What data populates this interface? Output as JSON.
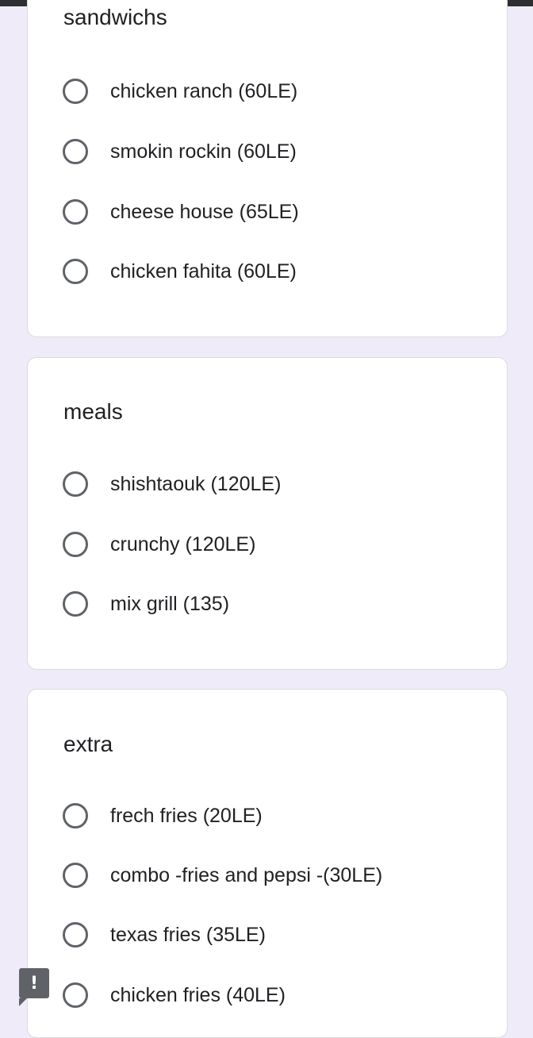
{
  "sections": [
    {
      "title": "sandwichs",
      "options": [
        "chicken ranch (60LE)",
        "smokin rockin (60LE)",
        "cheese house (65LE)",
        "chicken fahita (60LE)"
      ]
    },
    {
      "title": "meals",
      "options": [
        "shishtaouk (120LE)",
        "crunchy (120LE)",
        "mix grill (135)"
      ]
    },
    {
      "title": "extra",
      "options": [
        "frech fries (20LE)",
        "combo -fries and pepsi -(30LE)",
        "texas fries (35LE)",
        "chicken fries (40LE)"
      ]
    }
  ],
  "feedback": {
    "icon": "report-icon",
    "glyph": "!"
  },
  "colors": {
    "background": "#f0ebf8",
    "card": "#ffffff",
    "radio_border": "#5f6368",
    "text": "#202124"
  }
}
